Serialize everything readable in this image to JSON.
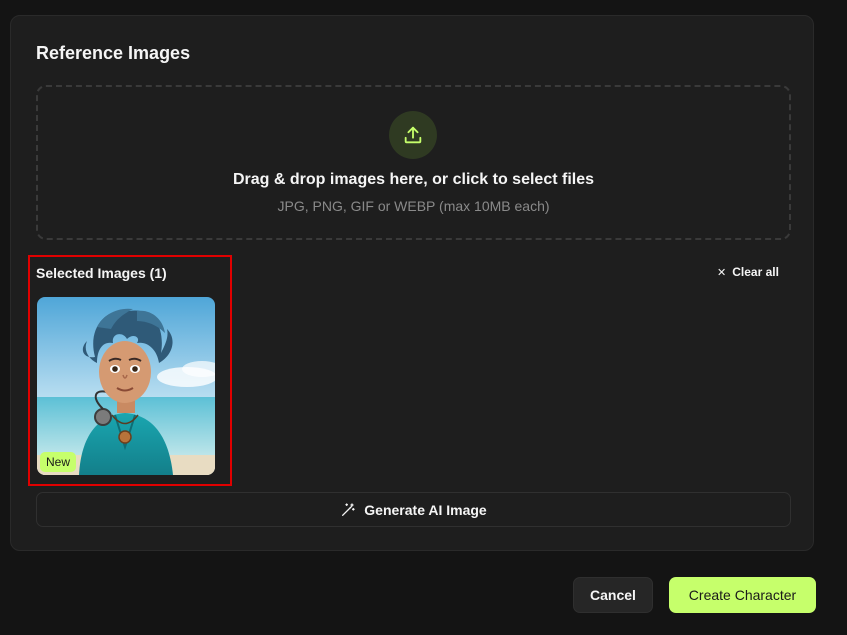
{
  "dialog": {
    "title": "Reference Images"
  },
  "dropzone": {
    "title": "Drag & drop images here, or click to select files",
    "subtitle": "JPG, PNG, GIF or WEBP (max 10MB each)",
    "icon": "upload-icon"
  },
  "selected": {
    "label": "Selected Images (1)",
    "clear_all_label": "Clear all",
    "clear_icon": "close-icon",
    "images": [
      {
        "badge": "New"
      }
    ]
  },
  "generate": {
    "label": "Generate AI Image",
    "icon": "magic-wand-icon"
  },
  "footer": {
    "cancel_label": "Cancel",
    "create_label": "Create Character"
  },
  "colors": {
    "accent": "#c6ff6b",
    "highlight": "#e00000",
    "background": "#141414",
    "panel": "#1e1e1e"
  }
}
